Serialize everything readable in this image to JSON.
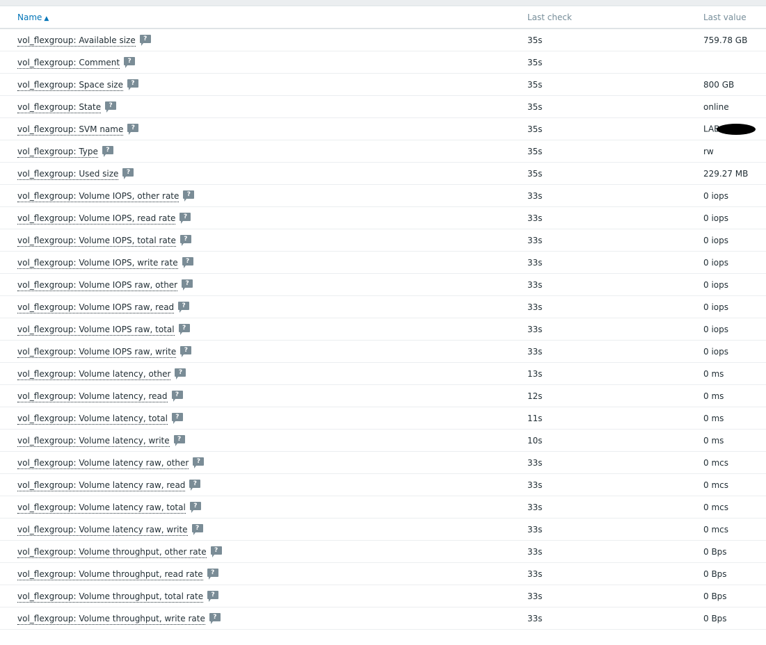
{
  "table": {
    "headers": {
      "name": "Name",
      "last_check": "Last check",
      "last_value": "Last value"
    },
    "sort_indicator": "▲",
    "hint_glyph": "?",
    "rows": [
      {
        "name": "vol_flexgroup: Available size",
        "last_check": "35s",
        "last_value": "759.78 GB"
      },
      {
        "name": "vol_flexgroup: Comment",
        "last_check": "35s",
        "last_value": ""
      },
      {
        "name": "vol_flexgroup: Space size",
        "last_check": "35s",
        "last_value": "800 GB"
      },
      {
        "name": "vol_flexgroup: State",
        "last_check": "35s",
        "last_value": "online"
      },
      {
        "name": "vol_flexgroup: SVM name",
        "last_check": "35s",
        "last_value": "LAB",
        "redacted": true
      },
      {
        "name": "vol_flexgroup: Type",
        "last_check": "35s",
        "last_value": "rw"
      },
      {
        "name": "vol_flexgroup: Used size",
        "last_check": "35s",
        "last_value": "229.27 MB"
      },
      {
        "name": "vol_flexgroup: Volume IOPS, other rate",
        "last_check": "33s",
        "last_value": "0 iops"
      },
      {
        "name": "vol_flexgroup: Volume IOPS, read rate",
        "last_check": "33s",
        "last_value": "0 iops"
      },
      {
        "name": "vol_flexgroup: Volume IOPS, total rate",
        "last_check": "33s",
        "last_value": "0 iops"
      },
      {
        "name": "vol_flexgroup: Volume IOPS, write rate",
        "last_check": "33s",
        "last_value": "0 iops"
      },
      {
        "name": "vol_flexgroup: Volume IOPS raw, other",
        "last_check": "33s",
        "last_value": "0 iops"
      },
      {
        "name": "vol_flexgroup: Volume IOPS raw, read",
        "last_check": "33s",
        "last_value": "0 iops"
      },
      {
        "name": "vol_flexgroup: Volume IOPS raw, total",
        "last_check": "33s",
        "last_value": "0 iops"
      },
      {
        "name": "vol_flexgroup: Volume IOPS raw, write",
        "last_check": "33s",
        "last_value": "0 iops"
      },
      {
        "name": "vol_flexgroup: Volume latency, other",
        "last_check": "13s",
        "last_value": "0 ms"
      },
      {
        "name": "vol_flexgroup: Volume latency, read",
        "last_check": "12s",
        "last_value": "0 ms"
      },
      {
        "name": "vol_flexgroup: Volume latency, total",
        "last_check": "11s",
        "last_value": "0 ms"
      },
      {
        "name": "vol_flexgroup: Volume latency, write",
        "last_check": "10s",
        "last_value": "0 ms"
      },
      {
        "name": "vol_flexgroup: Volume latency raw, other",
        "last_check": "33s",
        "last_value": "0 mcs"
      },
      {
        "name": "vol_flexgroup: Volume latency raw, read",
        "last_check": "33s",
        "last_value": "0 mcs"
      },
      {
        "name": "vol_flexgroup: Volume latency raw, total",
        "last_check": "33s",
        "last_value": "0 mcs"
      },
      {
        "name": "vol_flexgroup: Volume latency raw, write",
        "last_check": "33s",
        "last_value": "0 mcs"
      },
      {
        "name": "vol_flexgroup: Volume throughput, other rate",
        "last_check": "33s",
        "last_value": "0 Bps"
      },
      {
        "name": "vol_flexgroup: Volume throughput, read rate",
        "last_check": "33s",
        "last_value": "0 Bps"
      },
      {
        "name": "vol_flexgroup: Volume throughput, total rate",
        "last_check": "33s",
        "last_value": "0 Bps"
      },
      {
        "name": "vol_flexgroup: Volume throughput, write rate",
        "last_check": "33s",
        "last_value": "0 Bps"
      }
    ]
  }
}
